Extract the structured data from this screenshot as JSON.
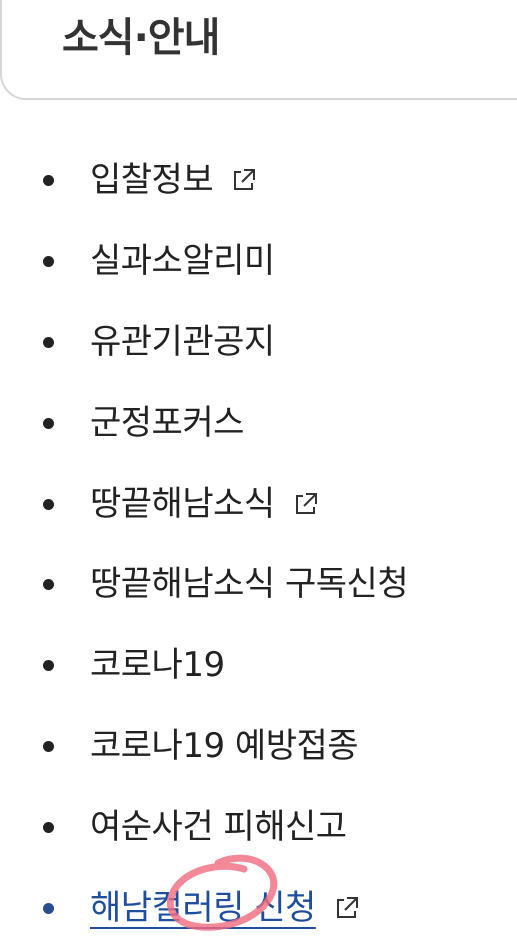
{
  "section": {
    "title": "소식·안내"
  },
  "menu": {
    "items": [
      {
        "label": "입찰정보",
        "external": true,
        "active": false
      },
      {
        "label": "실과소알리미",
        "external": false,
        "active": false
      },
      {
        "label": "유관기관공지",
        "external": false,
        "active": false
      },
      {
        "label": "군정포커스",
        "external": false,
        "active": false
      },
      {
        "label": "땅끝해남소식",
        "external": true,
        "active": false
      },
      {
        "label": "땅끝해남소식 구독신청",
        "external": false,
        "active": false
      },
      {
        "label": "코로나19",
        "external": false,
        "active": false
      },
      {
        "label": "코로나19 예방접종",
        "external": false,
        "active": false
      },
      {
        "label": "여순사건 피해신고",
        "external": false,
        "active": false
      },
      {
        "label": "해남컬러링 신청",
        "external": true,
        "active": true
      }
    ]
  },
  "colors": {
    "text": "#222222",
    "active_link": "#1f4e9c",
    "border": "#d6d6d6",
    "scribble": "#f06b7e"
  },
  "icons": {
    "external": "external-link-icon"
  }
}
